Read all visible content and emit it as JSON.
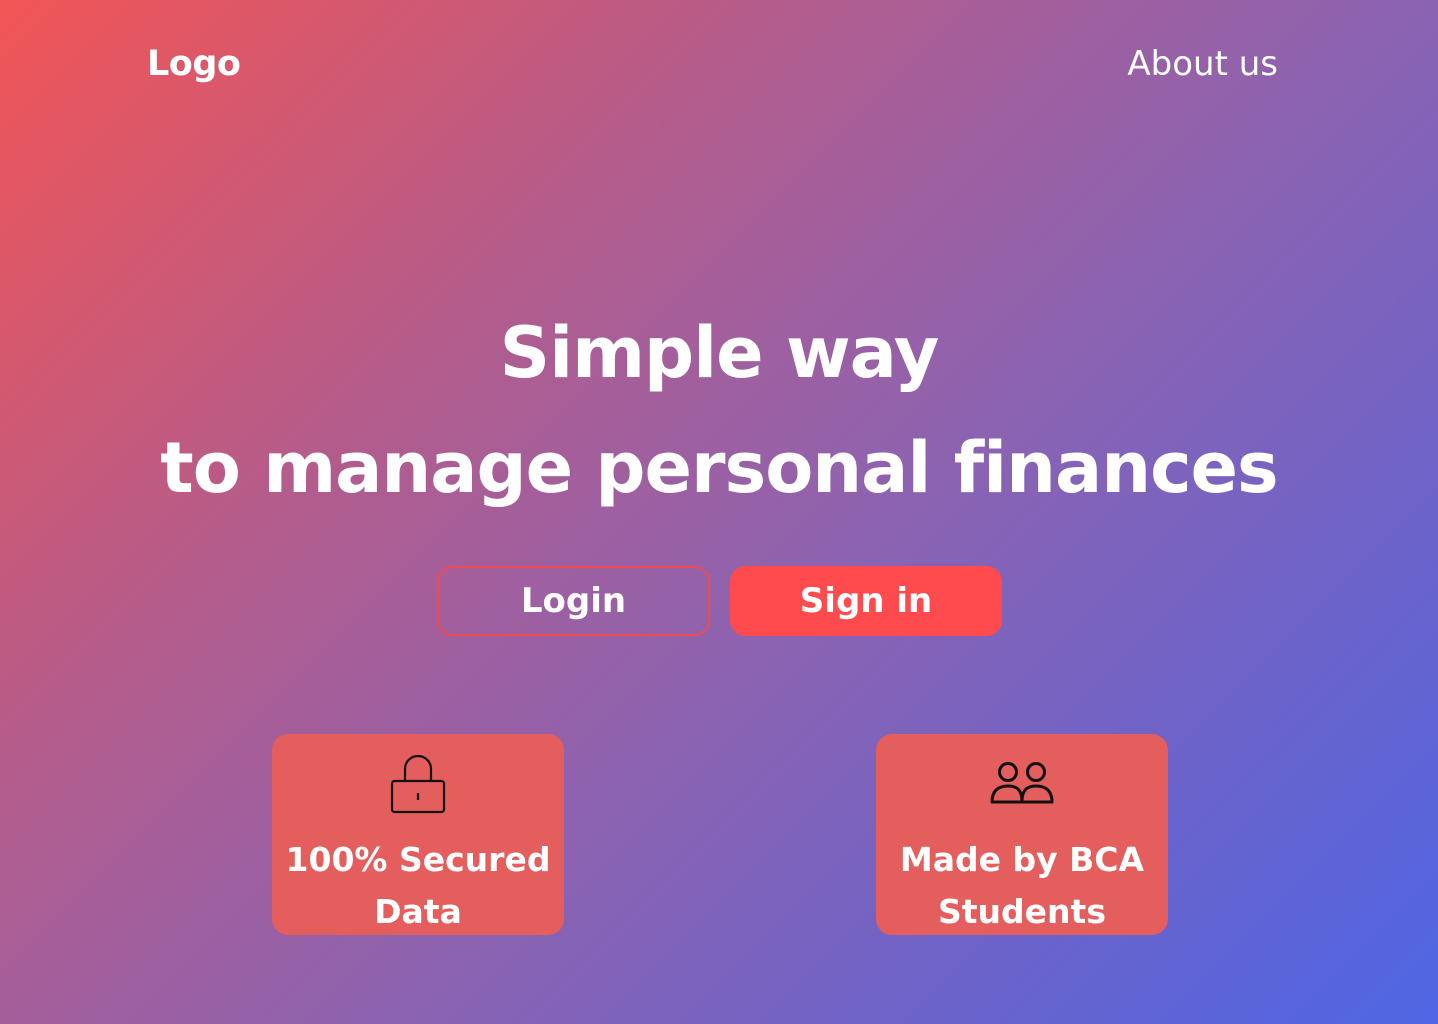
{
  "header": {
    "logo": "Logo",
    "about_link": "About us"
  },
  "hero": {
    "line1": "Simple way",
    "line2": "to manage personal finances"
  },
  "actions": {
    "login_label": "Login",
    "signin_label": "Sign in"
  },
  "features": [
    {
      "icon": "lock-icon",
      "line1": "100% Secured",
      "line2": "Data"
    },
    {
      "icon": "users-icon",
      "line1": "Made by BCA",
      "line2": "Students"
    }
  ],
  "colors": {
    "gradient_start": "#f25555",
    "gradient_end": "#4f66e5",
    "accent": "#ff4b4e",
    "card": "#e35e5d",
    "text": "#ffffff"
  }
}
